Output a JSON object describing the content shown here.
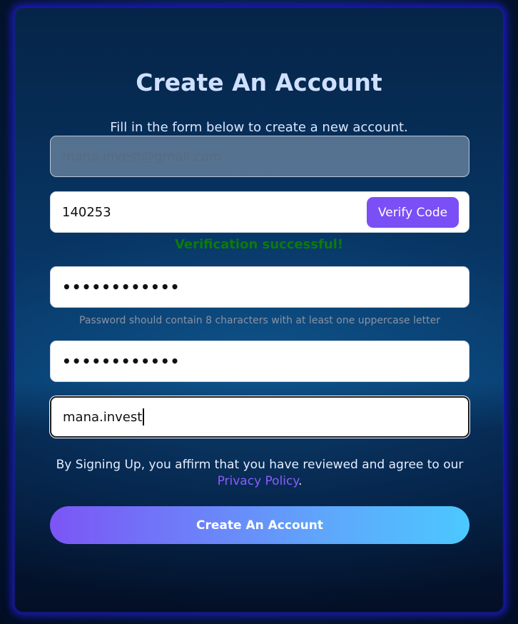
{
  "header": {
    "title": "Create An Account",
    "subtitle": "Fill in the form below to create a new account."
  },
  "form": {
    "email": {
      "placeholder": "mana.invest@gmail.com",
      "value": ""
    },
    "verification_code": {
      "value": "140253",
      "button_label": "Verify Code",
      "status": "Verification successful!"
    },
    "password": {
      "masked_value": "••••••••••••",
      "hint": "Password should contain 8 characters with at least one uppercase letter"
    },
    "confirm_password": {
      "masked_value": "••••••••••••"
    },
    "username": {
      "value": "mana.invest"
    }
  },
  "agreement": {
    "text": "By Signing Up, you affirm that you have reviewed and agree to our ",
    "link_label": "Privacy Policy",
    "suffix": "."
  },
  "submit": {
    "label": "Create An Account"
  },
  "colors": {
    "accent": "#7a4ff5",
    "success": "#0c7a0c",
    "link": "#8b5cff",
    "button_gradient_start": "#7c55f6",
    "button_gradient_end": "#4cc8ff",
    "card_glow": "#1a1aa8"
  }
}
